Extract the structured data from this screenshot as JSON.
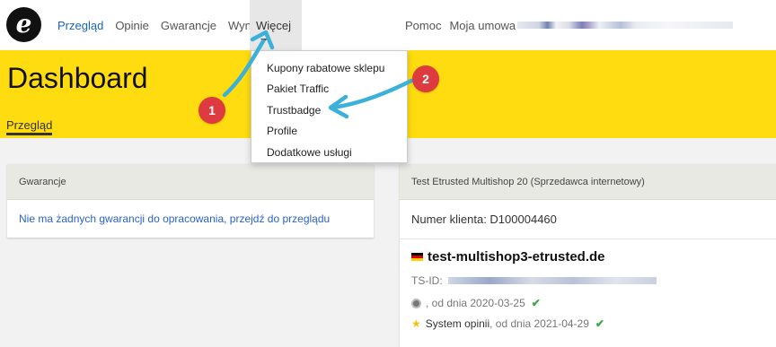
{
  "logo": {
    "glyph": "e"
  },
  "nav": {
    "items": [
      "Przegląd",
      "Opinie",
      "Gwarancje",
      "Wyniki"
    ],
    "more_label": "Więcej",
    "help": "Pomoc",
    "contract": "Moja umowa"
  },
  "dropdown": {
    "items": [
      "Kupony rabatowe sklepu",
      "Pakiet Traffic",
      "Trustbadge",
      "Profile",
      "Dodatkowe usługi"
    ]
  },
  "header": {
    "title": "Dashboard",
    "tab": "Przegląd"
  },
  "guarantees_card": {
    "title": "Gwarancje",
    "message": "Nie ma żadnych gwarancji do opracowania, przejdź do przeglądu"
  },
  "shop_card": {
    "title": "Test Etrusted Multishop 20 (Sprzedawca internetowy)",
    "customer_number": "Numer klienta: D100004460",
    "shop_name": "test-multishop3-etrusted.de",
    "ts_id_label": "TS-ID:",
    "seal_line": ", od dnia 2020-03-25",
    "reviews_label": "System opinii",
    "reviews_date": ", od dnia 2021-04-29"
  },
  "annotations": {
    "badge1": "1",
    "badge2": "2"
  },
  "colors": {
    "brand_yellow": "#ffdc0f",
    "accent_blue": "#1565c0",
    "annotation_red": "#dd3b3f",
    "annotation_arrow": "#3bb0d8",
    "check_green": "#39a845"
  }
}
